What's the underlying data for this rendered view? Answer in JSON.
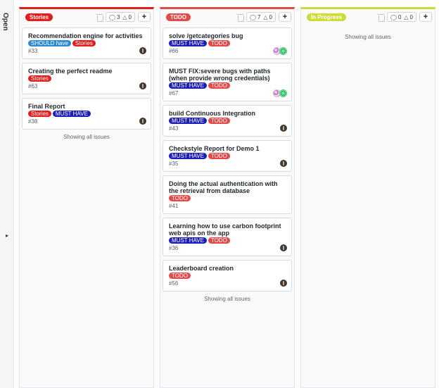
{
  "sidebar": {
    "title": "Open"
  },
  "colors": {
    "stories": "#e11d1d",
    "todo": "#e34a4a",
    "in_progress": "#cddc39",
    "should": "#2b8ad6",
    "must": "#1d1db8"
  },
  "columns": [
    {
      "label": "Stories",
      "color": "#e11d1d",
      "issues_count": "3",
      "pr_count": "0",
      "cards": [
        {
          "title": "Recommendation engine for activities",
          "labels": [
            {
              "text": "SHOULD have",
              "color": "#2b8ad6"
            },
            {
              "text": "Stories",
              "color": "#e11d1d"
            }
          ],
          "number": "#33",
          "avatar": "single"
        },
        {
          "title": "Creating the perfect readme",
          "labels": [
            {
              "text": "Stories",
              "color": "#e11d1d"
            }
          ],
          "number": "#63",
          "avatar": "single"
        },
        {
          "title": "Final Report",
          "labels": [
            {
              "text": "Stories",
              "color": "#e11d1d"
            },
            {
              "text": "MUST HAVE",
              "color": "#1d1db8"
            }
          ],
          "number": "#38",
          "avatar": "single"
        }
      ],
      "footer": "Showing all issues"
    },
    {
      "label": "TODO",
      "color": "#e34a4a",
      "issues_count": "7",
      "pr_count": "0",
      "cards": [
        {
          "title": "solve /getcategories bug",
          "labels": [
            {
              "text": "MUST HAVE",
              "color": "#1d1db8"
            },
            {
              "text": "TODO",
              "color": "#e34a4a"
            }
          ],
          "number": "#66",
          "avatar": "pair"
        },
        {
          "title": "MUST FIX:severe bugs with paths (when provide wrong credentials)",
          "labels": [
            {
              "text": "MUST HAVE",
              "color": "#1d1db8"
            },
            {
              "text": "TODO",
              "color": "#e34a4a"
            }
          ],
          "number": "#67",
          "avatar": "pair"
        },
        {
          "title": "build Continuous Integration",
          "labels": [
            {
              "text": "MUST HAVE",
              "color": "#1d1db8"
            },
            {
              "text": "TODO",
              "color": "#e34a4a"
            }
          ],
          "number": "#43",
          "avatar": "single"
        },
        {
          "title": "Checkstyle Report for Demo 1",
          "labels": [
            {
              "text": "MUST HAVE",
              "color": "#1d1db8"
            },
            {
              "text": "TODO",
              "color": "#e34a4a"
            }
          ],
          "number": "#35",
          "avatar": "single"
        },
        {
          "title": "Doing the actual authentication with the retrieval from database",
          "labels": [
            {
              "text": "TODO",
              "color": "#e34a4a"
            }
          ],
          "number": "#41",
          "avatar": "none"
        },
        {
          "title": "Learning how to use carbon footprint web apis on the app",
          "labels": [
            {
              "text": "MUST HAVE",
              "color": "#1d1db8"
            },
            {
              "text": "TODO",
              "color": "#e34a4a"
            }
          ],
          "number": "#36",
          "avatar": "single"
        },
        {
          "title": "Leaderboard creation",
          "labels": [
            {
              "text": "TODO",
              "color": "#e34a4a"
            }
          ],
          "number": "#56",
          "avatar": "single"
        }
      ],
      "footer": "Showing all issues"
    },
    {
      "label": "In Progress",
      "color": "#cddc39",
      "issues_count": "0",
      "pr_count": "0",
      "cards": [],
      "footer": "Showing all issues"
    }
  ]
}
